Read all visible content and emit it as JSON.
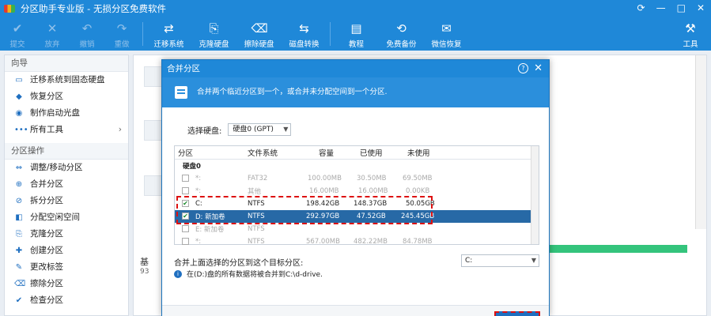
{
  "window": {
    "title": "分区助手专业版 - 无损分区免费软件",
    "controls": [
      "⟳",
      "—",
      "□",
      "✕"
    ]
  },
  "toolbar": {
    "items": [
      {
        "label": "提交",
        "icon": "✔",
        "enabled": false
      },
      {
        "label": "放弃",
        "icon": "✕",
        "enabled": false
      },
      {
        "label": "撤销",
        "icon": "↶",
        "enabled": false
      },
      {
        "label": "重做",
        "icon": "↷",
        "enabled": false
      },
      {
        "label": "迁移系统",
        "icon": "⇄",
        "enabled": true
      },
      {
        "label": "克隆硬盘",
        "icon": "⎘",
        "enabled": true
      },
      {
        "label": "擦除硬盘",
        "icon": "⌫",
        "enabled": true
      },
      {
        "label": "磁盘转换",
        "icon": "⇆",
        "enabled": true
      },
      {
        "label": "教程",
        "icon": "▤",
        "enabled": true
      },
      {
        "label": "免费备份",
        "icon": "⟲",
        "enabled": true
      },
      {
        "label": "微信恢复",
        "icon": "✉",
        "enabled": true
      }
    ],
    "tools_label": "工具"
  },
  "sidebar": {
    "wizard_header": "向导",
    "wizard_items": [
      {
        "label": "迁移系统到固态硬盘",
        "icon": "▭"
      },
      {
        "label": "恢复分区",
        "icon": "◆"
      },
      {
        "label": "制作启动光盘",
        "icon": "◉"
      },
      {
        "label": "所有工具",
        "icon": "•••"
      }
    ],
    "ops_header": "分区操作",
    "ops_items": [
      {
        "label": "调整/移动分区",
        "icon": "⇔"
      },
      {
        "label": "合并分区",
        "icon": "⊕"
      },
      {
        "label": "拆分分区",
        "icon": "⊘"
      },
      {
        "label": "分配空闲空间",
        "icon": "◧"
      },
      {
        "label": "克隆分区",
        "icon": "⎘"
      },
      {
        "label": "创建分区",
        "icon": "✚"
      },
      {
        "label": "更改标签",
        "icon": "✎"
      },
      {
        "label": "擦除分区",
        "icon": "⌫"
      },
      {
        "label": "检查分区",
        "icon": "✔"
      }
    ]
  },
  "main": {
    "ghost_text": "基",
    "ghost_num": "93"
  },
  "dialog": {
    "title": "合并分区",
    "help": "?",
    "close": "✕",
    "banner": "合并两个临近分区到一个，或合并未分配空间到一个分区.",
    "select_disk_label": "选择硬盘:",
    "select_disk_value": "硬盘0 (GPT)",
    "table": {
      "headers": [
        "分区",
        "文件系统",
        "容量",
        "已使用",
        "未使用"
      ],
      "group": "硬盘0",
      "rows": [
        {
          "name": "*:",
          "fs": "FAT32",
          "cap": "100.00MB",
          "used": "30.50MB",
          "free": "69.50MB",
          "checked": false,
          "state": "grey"
        },
        {
          "name": "*:",
          "fs": "其他",
          "cap": "16.00MB",
          "used": "16.00MB",
          "free": "0.00KB",
          "checked": false,
          "state": "grey"
        },
        {
          "name": "C:",
          "fs": "NTFS",
          "cap": "198.42GB",
          "used": "148.37GB",
          "free": "50.05GB",
          "checked": true,
          "state": "normal"
        },
        {
          "name": "D: 新加卷",
          "fs": "NTFS",
          "cap": "292.97GB",
          "used": "47.52GB",
          "free": "245.45GB",
          "checked": true,
          "state": "selected"
        },
        {
          "name": "E: 新加卷",
          "fs": "NTFS",
          "cap": "?",
          "used": "?",
          "free": "?",
          "checked": false,
          "state": "grey"
        },
        {
          "name": "*:",
          "fs": "NTFS",
          "cap": "567.00MB",
          "used": "482.22MB",
          "free": "84.78MB",
          "checked": false,
          "state": "grey"
        }
      ]
    },
    "merge_target_label": "合并上面选择的分区到这个目标分区:",
    "merge_target_value": "C:",
    "info_text": "在(D:)盘的所有数据将被合并到C:\\d-drive."
  }
}
